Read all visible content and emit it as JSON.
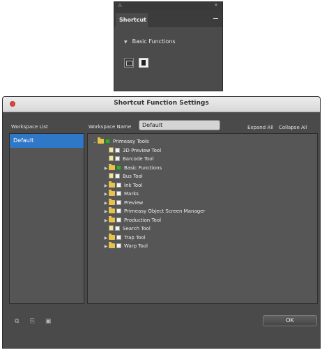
{
  "panel": {
    "tab_label": "Shortcut",
    "section_label": "Basic Functions",
    "grip_symbol": "⁂",
    "menu_symbol": "»",
    "icons": [
      "image-frame-icon",
      "document-page-icon"
    ]
  },
  "dialog": {
    "title": "Shortcut Function Settings",
    "workspace_list_label": "Workspace List",
    "workspace_name_label": "Workspace Name",
    "workspace_name_value": "Default",
    "expand_all": "Expand All",
    "collapse_all": "Collapse All",
    "workspaces": [
      "Default"
    ],
    "ok_label": "OK",
    "accent": "#2f78c8",
    "close_color": "#e0443e"
  },
  "tree": {
    "toggle_expanded": "⌄",
    "toggle_collapsed": "▶",
    "items": [
      {
        "label": "Primeasy Tools",
        "level": 0,
        "kind": "folder",
        "toggle": "expanded",
        "check": "green"
      },
      {
        "label": "3D Preview Tool",
        "level": 1,
        "kind": "doc",
        "toggle": "none",
        "check": "white"
      },
      {
        "label": "Barcode Tool",
        "level": 1,
        "kind": "doc",
        "toggle": "none",
        "check": "white"
      },
      {
        "label": "Basic Functions",
        "level": 1,
        "kind": "folder",
        "toggle": "collapsed",
        "check": "green"
      },
      {
        "label": "Bus Tool",
        "level": 1,
        "kind": "doc",
        "toggle": "none",
        "check": "white"
      },
      {
        "label": "Ink Tool",
        "level": 1,
        "kind": "folder",
        "toggle": "collapsed",
        "check": "white"
      },
      {
        "label": "Marks",
        "level": 1,
        "kind": "folder",
        "toggle": "collapsed",
        "check": "white"
      },
      {
        "label": "Preview",
        "level": 1,
        "kind": "folder",
        "toggle": "collapsed",
        "check": "white"
      },
      {
        "label": "Primeasy Object Screen Manager",
        "level": 1,
        "kind": "folder",
        "toggle": "collapsed",
        "check": "white"
      },
      {
        "label": "Production Tool",
        "level": 1,
        "kind": "folder",
        "toggle": "collapsed",
        "check": "white"
      },
      {
        "label": "Search Tool",
        "level": 1,
        "kind": "doc",
        "toggle": "none",
        "check": "white"
      },
      {
        "label": "Trap Tool",
        "level": 1,
        "kind": "folder",
        "toggle": "collapsed",
        "check": "white"
      },
      {
        "label": "Warp Tool",
        "level": 1,
        "kind": "folder",
        "toggle": "collapsed",
        "check": "white"
      }
    ]
  },
  "bottom_icons": [
    "add-workspace-icon",
    "duplicate-workspace-icon",
    "delete-workspace-icon"
  ],
  "bottom_glyphs": [
    "⧉",
    "⎘",
    "▣"
  ]
}
